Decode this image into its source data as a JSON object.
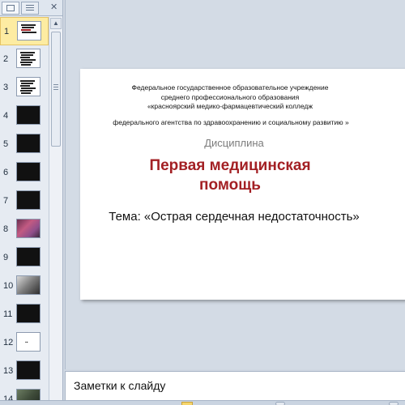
{
  "thumbnails": [
    {
      "num": "1",
      "kind": "title"
    },
    {
      "num": "2",
      "kind": "text"
    },
    {
      "num": "3",
      "kind": "text"
    },
    {
      "num": "4",
      "kind": "dark"
    },
    {
      "num": "5",
      "kind": "dark"
    },
    {
      "num": "6",
      "kind": "dark"
    },
    {
      "num": "7",
      "kind": "dark"
    },
    {
      "num": "8",
      "kind": "photo"
    },
    {
      "num": "9",
      "kind": "dark"
    },
    {
      "num": "10",
      "kind": "photo2"
    },
    {
      "num": "11",
      "kind": "dark"
    },
    {
      "num": "12",
      "kind": "mini"
    },
    {
      "num": "13",
      "kind": "dark"
    },
    {
      "num": "14",
      "kind": "photo3"
    }
  ],
  "slide": {
    "institution_line1": "Федеральное государственное образовательное учреждение",
    "institution_line2": "среднего профессионального образования",
    "institution_line3": "«красноярский медико-фармацевтический колледж",
    "institution_line4": "федерального агентства по здравоохранению и социальному развитию »",
    "discipline": "Дисциплина",
    "course_title": "Первая медицинская помощь",
    "topic": "Тема: «Острая сердечная недостаточность»"
  },
  "notes": {
    "placeholder": "Заметки к слайду"
  },
  "colors": {
    "title_red": "#a32024",
    "selected_thumb": "#fdeca2"
  }
}
